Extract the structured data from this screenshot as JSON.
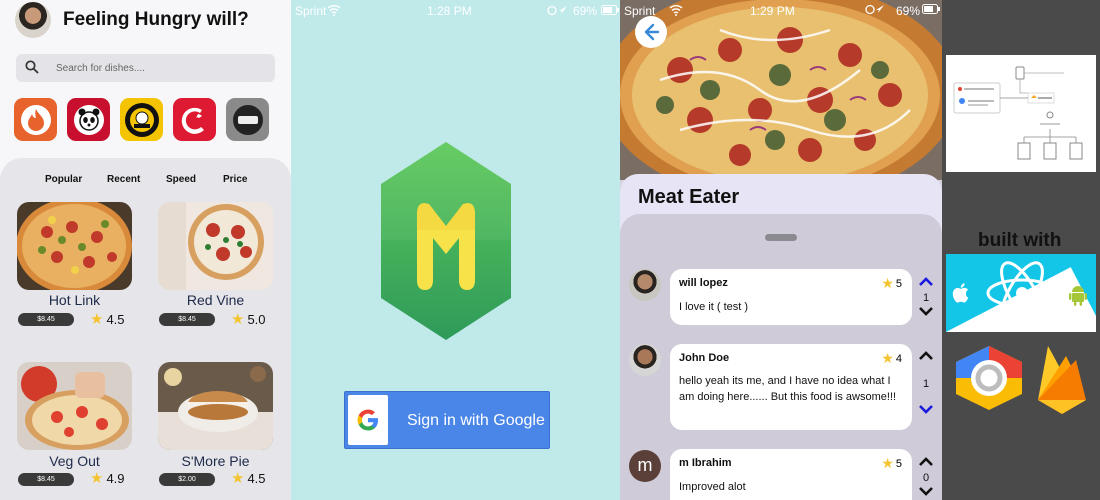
{
  "panel1": {
    "title": "Feeling Hungry will?",
    "search_placeholder": "Search for dishes....",
    "brands": [
      "fire-brand-icon",
      "panda-express-icon",
      "einstein-bros-bagels-icon",
      "chick-fil-a-icon",
      "cheese-board-icon"
    ],
    "tabs": [
      "Popular",
      "Recent",
      "Speed",
      "Price"
    ],
    "dishes": [
      {
        "name": "Hot Link",
        "price": "$8.45",
        "rating": "4.5"
      },
      {
        "name": "Red Vine",
        "price": "$8.45",
        "rating": "5.0"
      },
      {
        "name": "Veg Out",
        "price": "$8.45",
        "rating": "4.9"
      },
      {
        "name": "S'More Pie",
        "price": "$2.00",
        "rating": "4.5"
      }
    ]
  },
  "status_bar_login": {
    "carrier": "Sprint",
    "time": "1:28 PM",
    "battery": "69%"
  },
  "status_bar_detail": {
    "carrier": "Sprint",
    "time": "1:29 PM",
    "battery": "69%"
  },
  "login": {
    "button_label": "Sign in with Google"
  },
  "detail": {
    "dish_title": "Meat Eater",
    "comments": [
      {
        "name": "will lopez",
        "text": "I love it ( test )",
        "rating": "5",
        "votes": "1"
      },
      {
        "name": "John Doe",
        "text": "hello yeah its me, and I have no idea what I am doing here...... But this food is awsome!!!",
        "rating": "4",
        "votes": "1"
      },
      {
        "name": "m Ibrahim",
        "text": "Improved alot",
        "rating": "5",
        "votes": "0",
        "initial": "m"
      }
    ]
  },
  "side": {
    "built_with": "built with"
  },
  "colors": {
    "accent_blue": "#4a86e8",
    "login_bg": "#c0e9ea",
    "star": "#f4c430",
    "vote_up": "#111111",
    "vote_down": "#1a1adf"
  }
}
